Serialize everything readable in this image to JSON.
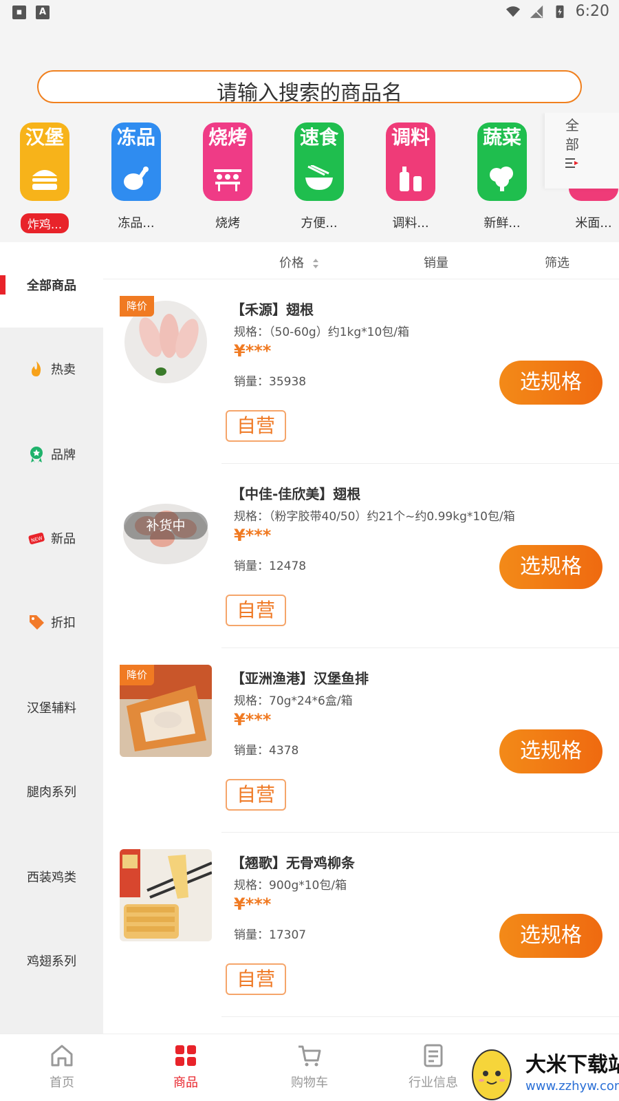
{
  "status_bar": {
    "time": "6:20"
  },
  "search": {
    "placeholder": "请输入搜索的商品名"
  },
  "categories": [
    {
      "tile_text": "汉堡",
      "label": "炸鸡...",
      "color": "#f7b31a",
      "active": true
    },
    {
      "tile_text": "冻品",
      "label": "冻品...",
      "color": "#2f8cf0",
      "active": false
    },
    {
      "tile_text": "烧烤",
      "label": "烧烤",
      "color": "#ef3b86",
      "active": false
    },
    {
      "tile_text": "速食",
      "label": "方便...",
      "color": "#1fbe4e",
      "active": false
    },
    {
      "tile_text": "调料",
      "label": "调料...",
      "color": "#ef3b78",
      "active": false
    },
    {
      "tile_text": "蔬菜",
      "label": "新鲜...",
      "color": "#1fbe4e",
      "active": false
    },
    {
      "tile_text": "",
      "label": "米面...",
      "color": "#ef3b78",
      "active": false
    }
  ],
  "all_button": {
    "line1": "全",
    "line2": "部"
  },
  "sidebar": [
    {
      "label": "全部商品",
      "icon": "",
      "active": true
    },
    {
      "label": "热卖",
      "icon": "fire-icon",
      "active": false
    },
    {
      "label": "品牌",
      "icon": "award-icon",
      "active": false
    },
    {
      "label": "新品",
      "icon": "new-badge-icon",
      "active": false
    },
    {
      "label": "折扣",
      "icon": "sale-tag-icon",
      "active": false
    },
    {
      "label": "汉堡辅料",
      "icon": "",
      "active": false
    },
    {
      "label": "腿肉系列",
      "icon": "",
      "active": false
    },
    {
      "label": "西装鸡类",
      "icon": "",
      "active": false
    },
    {
      "label": "鸡翅系列",
      "icon": "",
      "active": false
    }
  ],
  "sort_bar": {
    "price": "价格",
    "sales": "销量",
    "filter": "筛选"
  },
  "products": [
    {
      "name": "【禾源】翅根",
      "spec": "规格：（50-60g）约1kg*10包/箱",
      "price": "¥***",
      "sales": "销量：35938",
      "badge": "降价",
      "overlay": "",
      "button": "选规格",
      "self_tag": "自营"
    },
    {
      "name": "【中佳-佳欣美】翅根",
      "spec": "规格：（粉字胶带40/50）约21个~约0.99kg*10包/箱",
      "price": "¥***",
      "sales": "销量：12478",
      "badge": "",
      "overlay": "补货中",
      "button": "选规格",
      "self_tag": "自营"
    },
    {
      "name": "【亚洲渔港】汉堡鱼排",
      "spec": "规格：70g*24*6盒/箱",
      "price": "¥***",
      "sales": "销量：4378",
      "badge": "降价",
      "overlay": "",
      "button": "选规格",
      "self_tag": "自营"
    },
    {
      "name": "【翘歌】无骨鸡柳条",
      "spec": "规格：900g*10包/箱",
      "price": "¥***",
      "sales": "销量：17307",
      "badge": "",
      "overlay": "",
      "button": "选规格",
      "self_tag": "自营"
    }
  ],
  "bottom_nav": [
    {
      "label": "首页",
      "icon": "home-icon",
      "active": false
    },
    {
      "label": "商品",
      "icon": "grid-icon",
      "active": true
    },
    {
      "label": "购物车",
      "icon": "cart-icon",
      "active": false
    },
    {
      "label": "行业信息",
      "icon": "news-icon",
      "active": false
    }
  ],
  "watermark": {
    "title": "大米下载站",
    "url": "www.zzhyw.com"
  },
  "colors": {
    "accent": "#e8232a",
    "orange": "#f07a22",
    "search_border": "#f0801e"
  }
}
